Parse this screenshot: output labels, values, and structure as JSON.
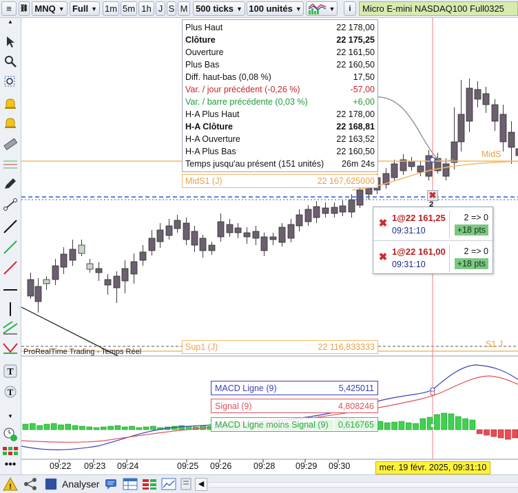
{
  "toolbar": {
    "symbol": "MNQ",
    "mode": "Full",
    "timeframes": [
      "1m",
      "5m",
      "1h",
      "J",
      "S",
      "M"
    ],
    "ticks": "500 ticks",
    "units": "100 unités",
    "instrument": "Micro E-mini NASDAQ100 Full0325"
  },
  "info_panel": {
    "rows": [
      {
        "label": "Plus Haut",
        "value": "22 178,00",
        "style": ""
      },
      {
        "label": "Clôture",
        "value": "22 175,25",
        "style": "b"
      },
      {
        "label": "Ouverture",
        "value": "22 161,50",
        "style": ""
      },
      {
        "label": "Plus Bas",
        "value": "22 160,50",
        "style": ""
      },
      {
        "label": "Diff. haut-bas (0,08 %)",
        "value": "17,50",
        "style": ""
      },
      {
        "label": "Var. / jour précédent (-0,26 %)",
        "value": "-57,00",
        "style": "red"
      },
      {
        "label": "Var. / barre précédente (0,03 %)",
        "value": "+6,00",
        "style": "green"
      },
      {
        "label": "H-A Plus Haut",
        "value": "22 178,00",
        "style": ""
      },
      {
        "label": "H-A Clôture",
        "value": "22 168,81",
        "style": "b"
      },
      {
        "label": "H-A Ouverture",
        "value": "22 163,52",
        "style": ""
      },
      {
        "label": "H-A Plus Bas",
        "value": "22 160,50",
        "style": ""
      },
      {
        "label": "Temps jusqu'au présent (151 unités)",
        "value": "26m 24s",
        "style": ""
      }
    ]
  },
  "levels": {
    "mid_label": "MidS1 (J)",
    "mid_value": "22 167,625000",
    "mid_right": "MidS",
    "sup_label": "Sup1 (J)",
    "sup_value": "22 116,833333",
    "sup_right": "S1 J"
  },
  "orders": [
    {
      "price": "1@22 161,25",
      "time": "09:31:10",
      "position": "2 => 0",
      "points": "+18 pts"
    },
    {
      "price": "1@22 161,00",
      "time": "09:31:10",
      "position": "2 => 0",
      "points": "+18 pts"
    }
  ],
  "order_count_marker": "2",
  "chart_label": "ProRealTime Trading - Temps Réel",
  "macd": {
    "line": {
      "label": "MACD Ligne (9)",
      "value": "5,425011",
      "color": "#3a3fb8"
    },
    "signal": {
      "label": "Signal (9)",
      "value": "4,808246",
      "color": "#d9545c"
    },
    "hist": {
      "label": "MACD Ligne moins Signal (9)",
      "value": "0,616765",
      "color": "#3fbf4f"
    }
  },
  "x_axis": {
    "labels": [
      "09:22",
      "09:23",
      "09:24",
      "09:25",
      "09:26",
      "09:28",
      "09:29",
      "09:30"
    ],
    "current": "mer. 19 févr. 2025, 09:31:10"
  },
  "bottom": {
    "analyser": "Analyser"
  }
}
